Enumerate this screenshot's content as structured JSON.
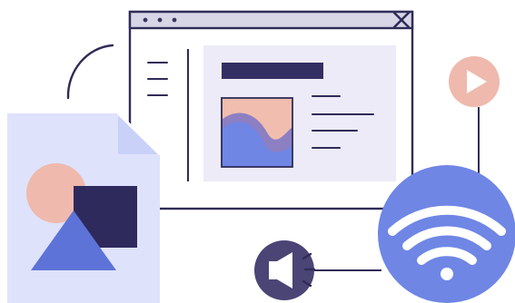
{
  "illustration": {
    "kind": "decorative-media-illustration",
    "icons": [
      "browser-window-icon",
      "document-shapes-icon",
      "play-icon",
      "megaphone-icon",
      "wifi-icon"
    ]
  },
  "colors": {
    "ink": "#2f2c58",
    "window_bar": "#d7d6e7",
    "window_panel": "#ecebf7",
    "lavender": "#dfe2fb",
    "periwinkle": "#c9d1f8",
    "blue": "#6f86e5",
    "blue_dark": "#5d73d8",
    "peach": "#efb9ad",
    "purple": "#6d5aa1",
    "navy": "#2f2a5c",
    "dots": "#3b365f"
  }
}
